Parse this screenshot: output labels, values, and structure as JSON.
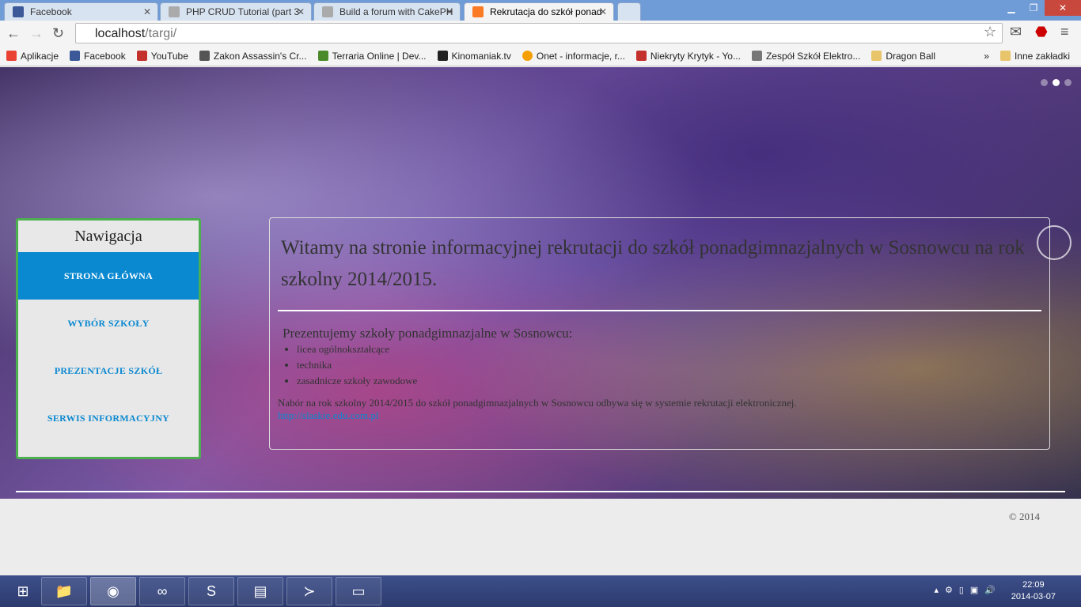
{
  "browser": {
    "tabs": [
      {
        "title": "Facebook",
        "icon": "facebook-icon",
        "color": "#3b5998",
        "active": false
      },
      {
        "title": "PHP CRUD Tutorial (part 3",
        "icon": "cakephp-icon",
        "color": "#888888",
        "active": false
      },
      {
        "title": "Build a forum with CakePH",
        "icon": "cakephp-icon",
        "color": "#888888",
        "active": false
      },
      {
        "title": "Rekrutacja do szkół ponad",
        "icon": "xampp-icon",
        "color": "#fb7a24",
        "active": true
      }
    ],
    "url_host": "localhost",
    "url_path": "/targi/",
    "bookmarks": [
      {
        "label": "Aplikacje",
        "color": "#e94235"
      },
      {
        "label": "Facebook",
        "color": "#3b5998"
      },
      {
        "label": "YouTube",
        "color": "#c4302b"
      },
      {
        "label": "Zakon Assassin's Cr...",
        "color": "#555555"
      },
      {
        "label": "Terraria Online | Dev...",
        "color": "#4a8a2a"
      },
      {
        "label": "Kinomaniak.tv",
        "color": "#222222"
      },
      {
        "label": "Onet - informacje, r...",
        "color": "#f5a000"
      },
      {
        "label": "Niekryty Krytyk - Yo...",
        "color": "#c4302b"
      },
      {
        "label": "Zespół Szkół Elektro...",
        "color": "#555555"
      },
      {
        "label": "Dragon Ball",
        "color": "#e8c46a"
      }
    ],
    "more": "»",
    "other_bookmarks": "Inne zakładki"
  },
  "sidebar": {
    "title": "Nawigacja",
    "items": [
      {
        "label": "STRONA GŁÓWNA",
        "active": true
      },
      {
        "label": "WYBÓR SZKOŁY"
      },
      {
        "label": "PREZENTACJE SZKÓŁ"
      },
      {
        "label": "SERWIS INFORMACYJNY"
      }
    ]
  },
  "main": {
    "heading": "Witamy na stronie informacyjnej rekrutacji do szkół ponadgimnazjalnych w Sosnowcu na rok szkolny 2014/2015.",
    "subheading": "Prezentujemy szkoły ponadgimnazjalne w Sosnowcu:",
    "list": [
      "licea ogólnokształcące",
      "technika",
      "zasadnicze szkoły zawodowe"
    ],
    "info": "Nabór na rok szkolny 2014/2015 do szkół ponadgimnazjalnych w Sosnowcu odbywa się w systemie rekrutacji elektronicznej.",
    "link": "http://slaskie.edu.com.pl"
  },
  "carousel": {
    "slides": 3,
    "active": 2
  },
  "footer": {
    "copyright": "© 2014"
  },
  "taskbar": {
    "time": "22:09",
    "date": "2014-03-07"
  },
  "colors": {
    "accent": "#0a88d0",
    "nav_border": "#4caf50"
  }
}
